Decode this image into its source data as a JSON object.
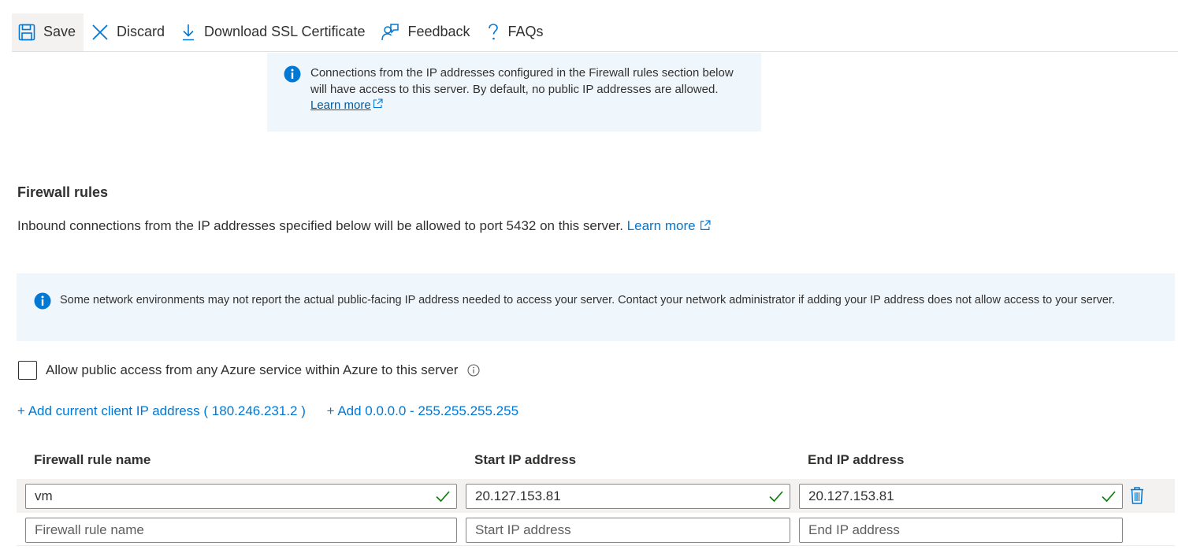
{
  "toolbar": {
    "save_label": "Save",
    "discard_label": "Discard",
    "download_label": "Download SSL Certificate",
    "feedback_label": "Feedback",
    "faqs_label": "FAQs"
  },
  "info_banner": {
    "text": "Connections from the IP addresses configured in the Firewall rules section below will have access to this server. By default, no public IP addresses are allowed.",
    "link_text": "Learn more"
  },
  "firewall": {
    "title": "Firewall rules",
    "description": "Inbound connections from the IP addresses specified below will be allowed to port 5432 on this server.",
    "learn_more": "Learn more",
    "network_note": "Some network environments may not report the actual public-facing IP address needed to access your server.  Contact your network administrator if adding your IP address does not allow access to your server.",
    "allow_azure_label": "Allow public access from any Azure service within Azure to this server",
    "add_client_ip": "+ Add current client IP address ( 180.246.231.2 )",
    "add_all_range": "+ Add 0.0.0.0 - 255.255.255.255",
    "columns": {
      "name": "Firewall rule name",
      "start": "Start IP address",
      "end": "End IP address"
    },
    "rules": [
      {
        "name": "vm",
        "start_ip": "20.127.153.81",
        "end_ip": "20.127.153.81"
      }
    ],
    "new_row_placeholders": {
      "name": "Firewall rule name",
      "start": "Start IP address",
      "end": "End IP address"
    }
  },
  "colors": {
    "accent": "#0078d4",
    "info_bg": "#eff6fc",
    "valid_check": "#107c10"
  }
}
